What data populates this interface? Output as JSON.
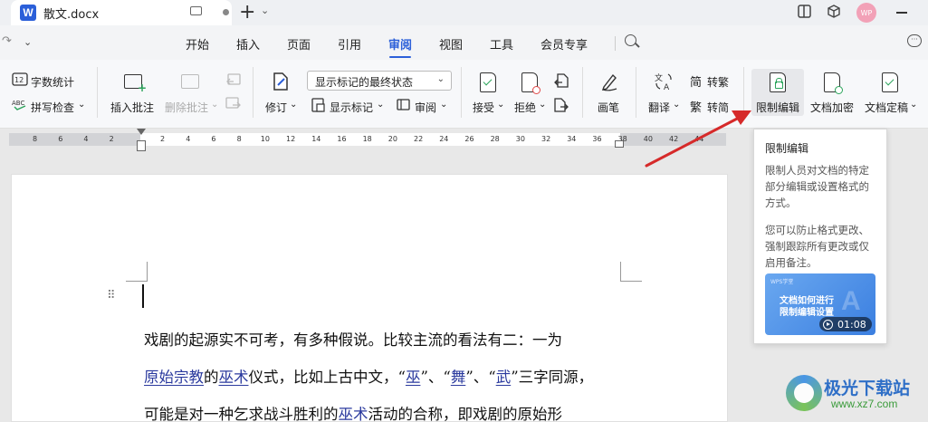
{
  "titlebar": {
    "doc_title": "散文.docx",
    "app_letter": "W",
    "new_tab": "+",
    "new_tab_chevron": "⌄",
    "avatar_text": "WP"
  },
  "menu": {
    "items": [
      "开始",
      "插入",
      "页面",
      "引用",
      "审阅",
      "视图",
      "工具",
      "会员专享"
    ],
    "active": "审阅",
    "redo_glyph": "↷",
    "chevron": "⌄"
  },
  "ribbon": {
    "word_count": "字数统计",
    "spell_check": "拼写检查",
    "insert_comment": "插入批注",
    "delete_comment": "删除批注",
    "revise": "修订",
    "markup_state": "显示标记的最终状态",
    "show_markup": "显示标记",
    "review": "审阅",
    "accept": "接受",
    "reject": "拒绝",
    "pen": "画笔",
    "translate": "翻译",
    "to_traditional": "转繁",
    "to_simplified": "转简",
    "restrict_edit": "限制编辑",
    "doc_encrypt": "文档加密",
    "doc_finalize": "文档定稿",
    "dropdown_glyph": "⌄"
  },
  "ruler": {
    "ticks": [
      "8",
      "6",
      "4",
      "2",
      "",
      "2",
      "4",
      "6",
      "8",
      "10",
      "12",
      "14",
      "16",
      "18",
      "20",
      "22",
      "24",
      "26",
      "28",
      "30",
      "32",
      "34",
      "36",
      "38",
      "40",
      "42",
      "44"
    ]
  },
  "document": {
    "line1": "戏剧的起源实不可考，有多种假说。比较主流的看法有二：一为",
    "line2_parts": [
      "原始宗教",
      "的",
      "巫术",
      "仪式，比如上古中文，“",
      "巫",
      "”、“",
      "舞",
      "”、“",
      "武",
      "”三字同源，"
    ],
    "line3_parts": [
      "可能是对一种乞求战斗胜利的",
      "巫术",
      "活动的合称，即戏剧的原始形"
    ]
  },
  "tooltip": {
    "title": "限制编辑",
    "desc": "限制人员对文档的特定部分编辑或设置格式的方式。",
    "desc2": "您可以防止格式更改、强制跟踪所有更改或仅启用备注。",
    "video_brand": "WPS学堂",
    "video_line1": "文档如何进行",
    "video_line2": "限制编辑设置",
    "video_duration": "01:08"
  },
  "watermark": {
    "name": "极光下载站",
    "url": "www.xz7.com"
  },
  "colors": {
    "accent": "#2b5fd9",
    "arrow": "#d62a2a",
    "link_underline": "#2b3a9e"
  }
}
